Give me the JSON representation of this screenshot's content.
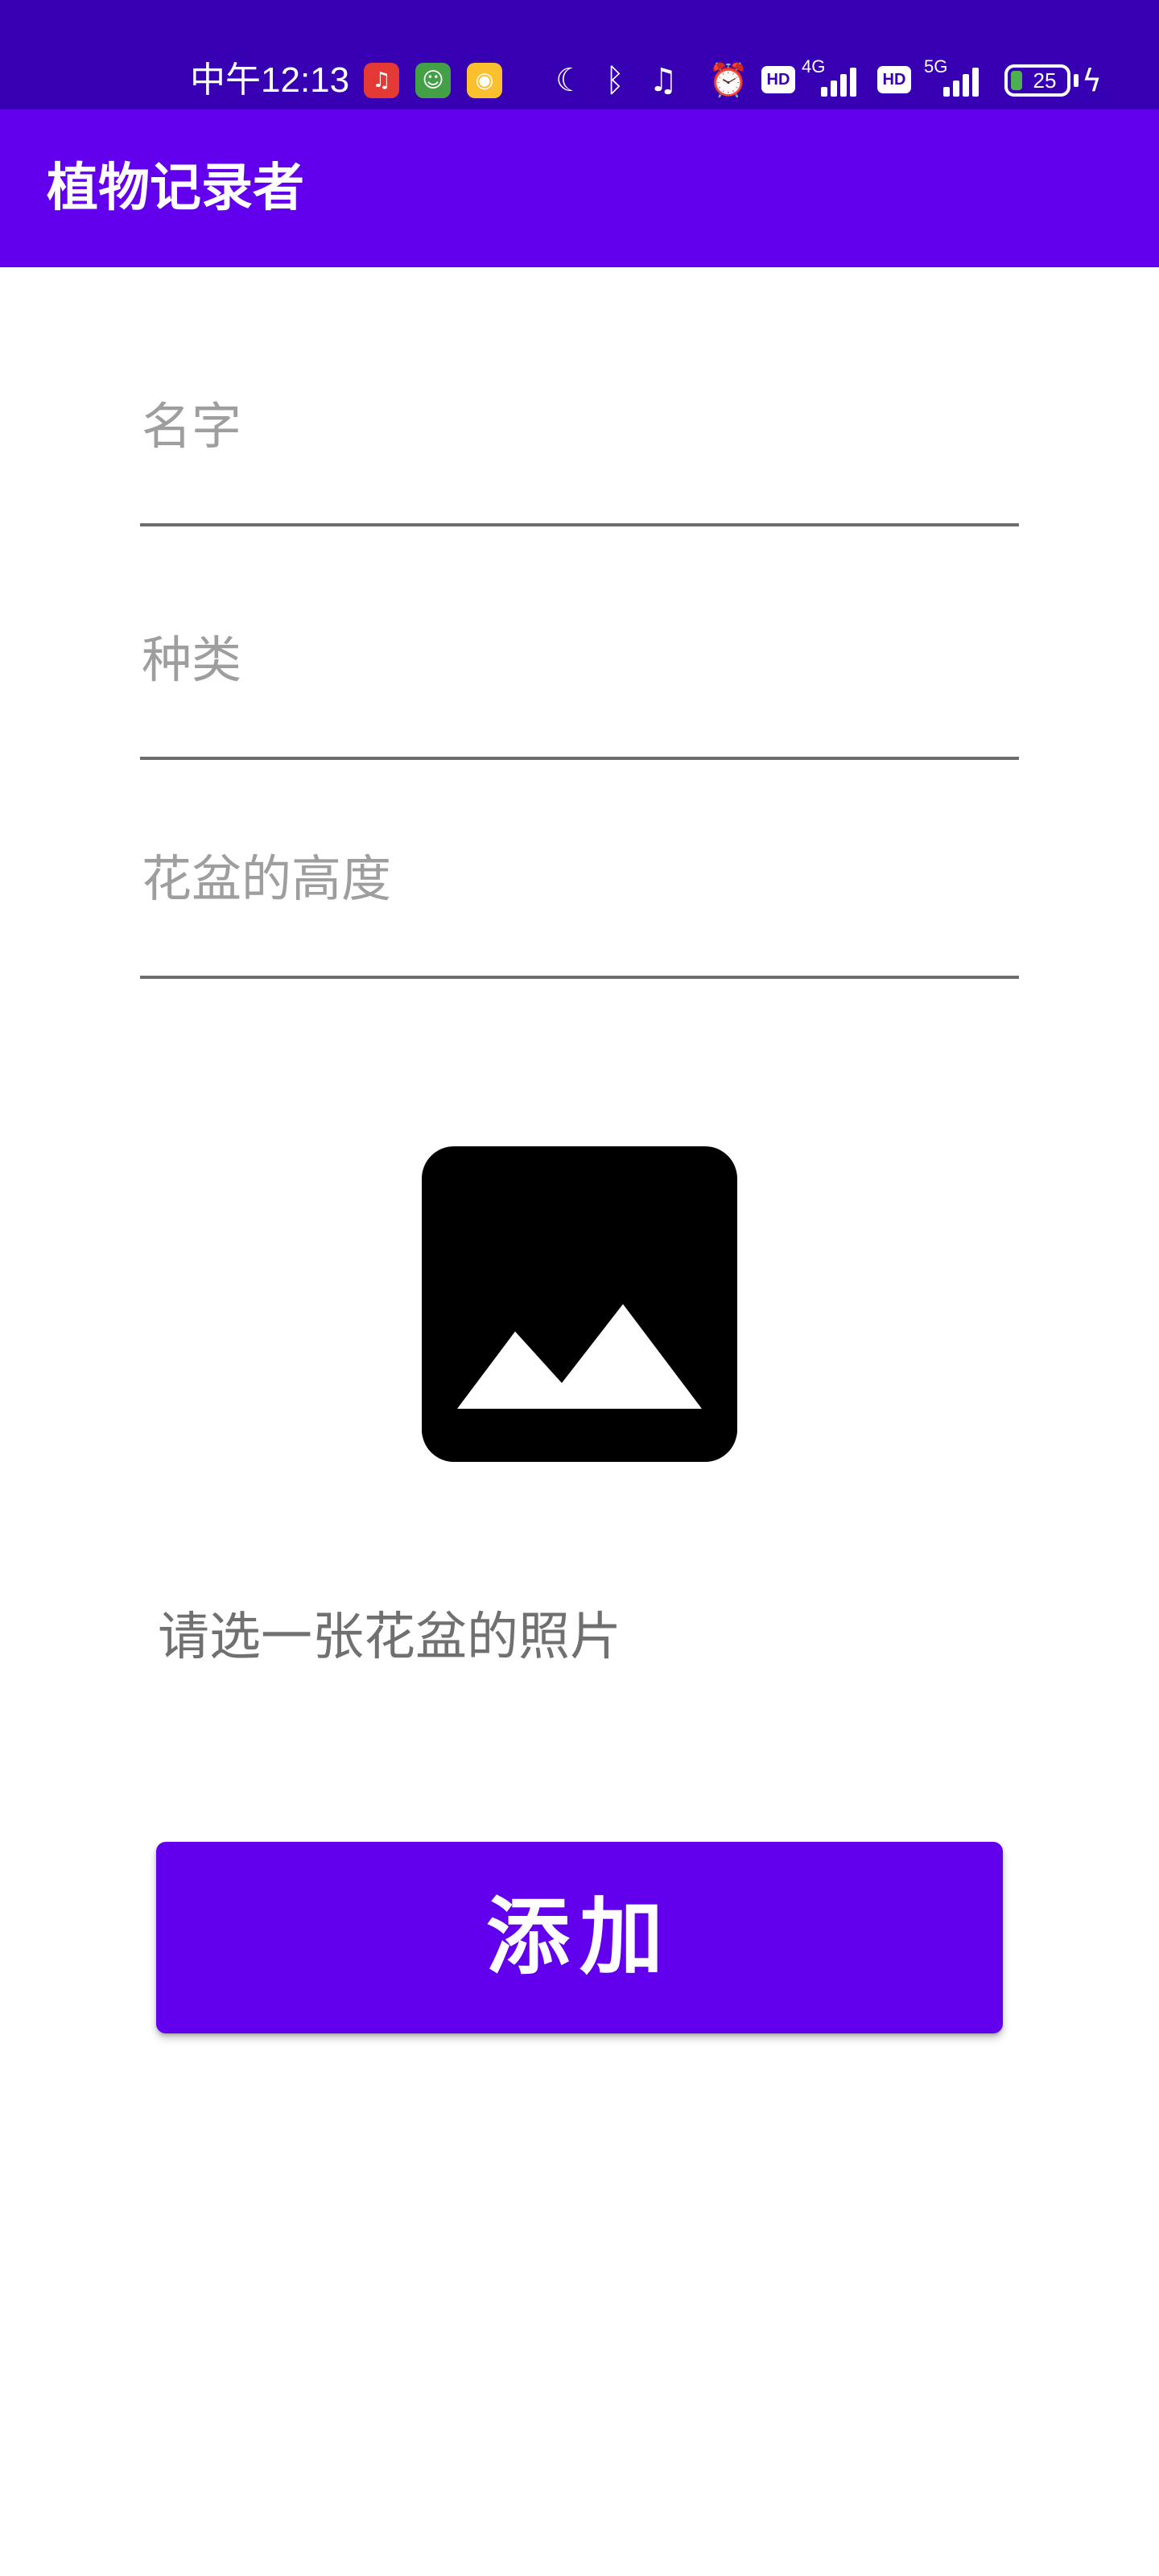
{
  "status_bar": {
    "time": "中午12:13",
    "network_4g": "4G",
    "network_5g": "5G",
    "hd_label": "HD",
    "battery_level": "25",
    "icons": [
      "netease-music-icon",
      "app-green-icon",
      "weibo-icon",
      "moon-icon",
      "bluetooth-icon",
      "vibrate-off-icon",
      "alarm-icon",
      "hd-icon",
      "signal-4g-icon",
      "hd-icon",
      "signal-5g-icon",
      "battery-icon",
      "charging-icon"
    ]
  },
  "app_bar": {
    "title": "植物记录者"
  },
  "form": {
    "name_placeholder": "名字",
    "species_placeholder": "种类",
    "pot_height_placeholder": "花盆的高度"
  },
  "image_picker": {
    "icon": "image-icon",
    "hint": "请选一张花盆的照片"
  },
  "add_button": {
    "label": "添加"
  },
  "colors": {
    "status_bar": "#3700b3",
    "primary": "#6200ee",
    "hint_text": "#9e9e9e",
    "underline": "#6d6d6d"
  }
}
